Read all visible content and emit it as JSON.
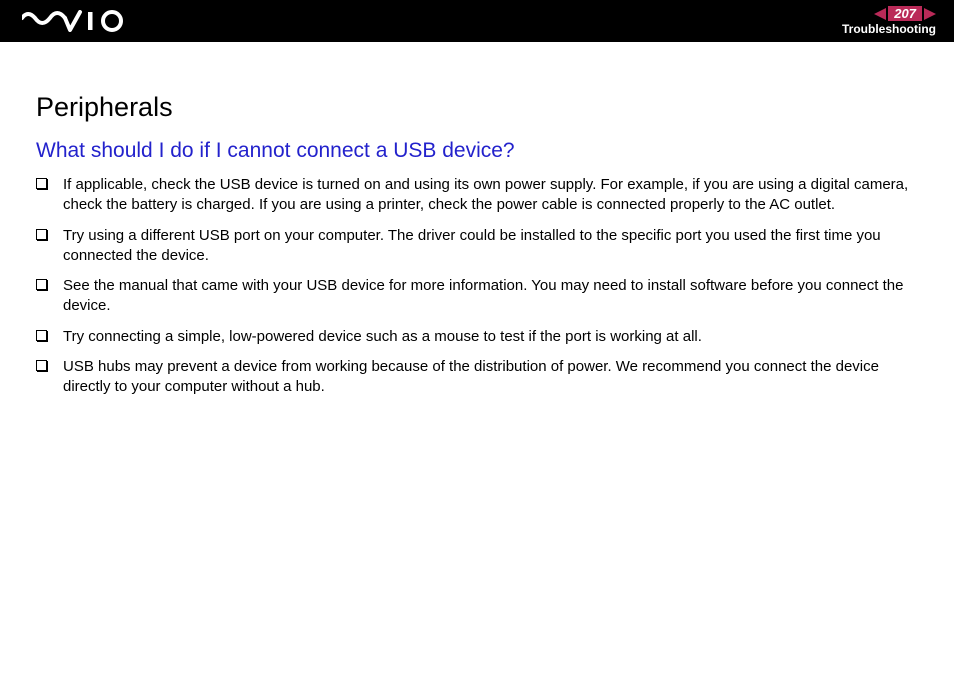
{
  "header": {
    "page_number": "207",
    "section_label": "Troubleshooting"
  },
  "content": {
    "title": "Peripherals",
    "question": "What should I do if I cannot connect a USB device?",
    "bullets": [
      "If applicable, check the USB device is turned on and using its own power supply. For example, if you are using a digital camera, check the battery is charged. If you are using a printer, check the power cable is connected properly to the AC outlet.",
      "Try using a different USB port on your computer. The driver could be installed to the specific port you used the first time you connected the device.",
      "See the manual that came with your USB device for more information. You may need to install software before you connect the device.",
      "Try connecting a simple, low-powered device such as a mouse to test if the port is working at all.",
      "USB hubs may prevent a device from working because of the distribution of power. We recommend you connect the device directly to your computer without a hub."
    ]
  }
}
